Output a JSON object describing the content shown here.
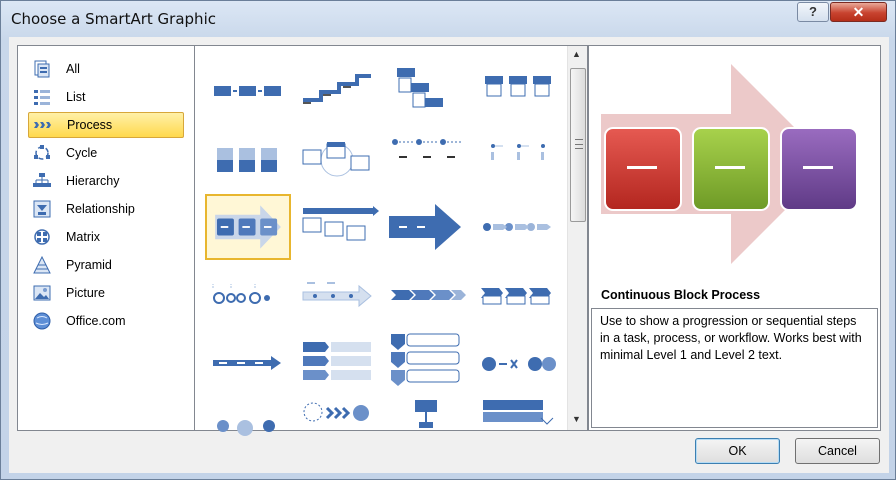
{
  "window": {
    "title": "Choose a SmartArt Graphic",
    "help_glyph": "?",
    "close_glyph": "✕"
  },
  "categories": [
    {
      "label": "All",
      "icon": "all-icon"
    },
    {
      "label": "List",
      "icon": "list-icon"
    },
    {
      "label": "Process",
      "icon": "process-icon",
      "selected": true
    },
    {
      "label": "Cycle",
      "icon": "cycle-icon"
    },
    {
      "label": "Hierarchy",
      "icon": "hierarchy-icon"
    },
    {
      "label": "Relationship",
      "icon": "relationship-icon"
    },
    {
      "label": "Matrix",
      "icon": "matrix-icon"
    },
    {
      "label": "Pyramid",
      "icon": "pyramid-icon"
    },
    {
      "label": "Picture",
      "icon": "picture-icon"
    },
    {
      "label": "Office.com",
      "icon": "office-com-icon"
    }
  ],
  "gallery": {
    "selected_index": 8,
    "columns": 4,
    "visible_rows": 6
  },
  "preview": {
    "title": "Continuous Block Process",
    "description": "Use to show a progression or sequential steps in a task, process, or workflow. Works best with minimal Level 1 and Level 2 text.",
    "block_colors": [
      "#c8302c",
      "#8cb83a",
      "#7a4f9f"
    ],
    "arrow_color": "#ecc9c9"
  },
  "buttons": {
    "ok": "OK",
    "cancel": "Cancel"
  },
  "colors": {
    "accent": "#3e6cb0",
    "selection": "#ffd94d"
  }
}
